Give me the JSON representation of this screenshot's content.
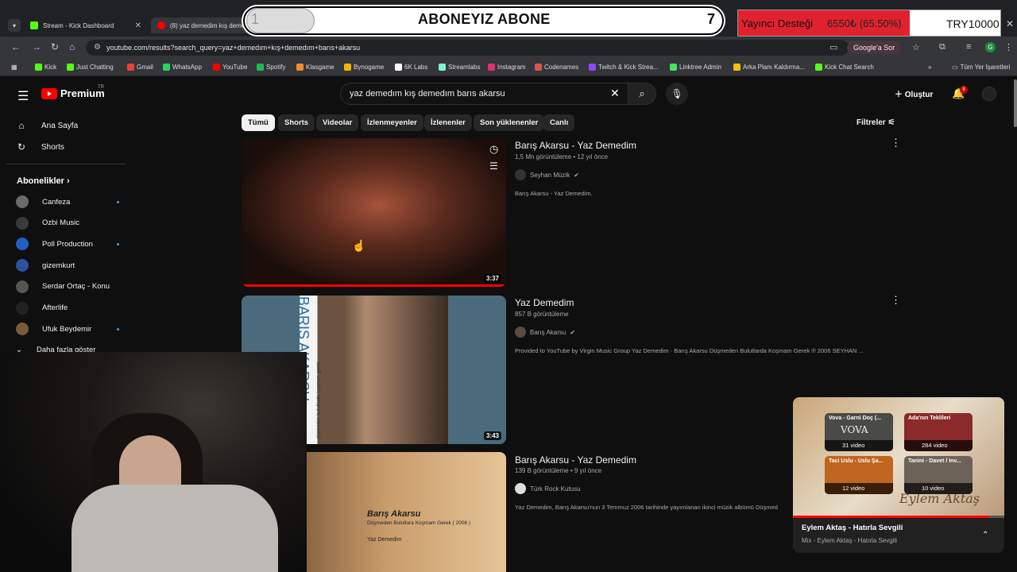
{
  "browser": {
    "tabs": [
      {
        "label": "Stream - Kick Dashboard",
        "favicon_color": "#53fc18"
      },
      {
        "label": "(8) yaz demedim kış demedi",
        "favicon_color": "#ff0000"
      }
    ],
    "url": "youtube.com/results?search_query=yaz+demedım+kış+demedım+barıs+akarsu",
    "google_sor": "Google'a Sor",
    "profile_initial": "G",
    "bookmarks": [
      {
        "label": "Kick",
        "color": "#53fc18"
      },
      {
        "label": "Just Chatting",
        "color": "#53fc18"
      },
      {
        "label": "Gmail",
        "color": "#ea4335"
      },
      {
        "label": "WhatsApp",
        "color": "#25d366"
      },
      {
        "label": "YouTube",
        "color": "#ff0000"
      },
      {
        "label": "Spotify",
        "color": "#1db954"
      },
      {
        "label": "Klasgame",
        "color": "#f28c28"
      },
      {
        "label": "Bynogame",
        "color": "#f4b400"
      },
      {
        "label": "6K Labs",
        "color": "#ffffff"
      },
      {
        "label": "Streamlabs",
        "color": "#80f5d2"
      },
      {
        "label": "Instagram",
        "color": "#e1306c"
      },
      {
        "label": "Codenames",
        "color": "#d9534f"
      },
      {
        "label": "Twitch & Kick Strea...",
        "color": "#9146ff"
      },
      {
        "label": "Linktree Admin",
        "color": "#43e55e"
      },
      {
        "label": "Arka Planı Kaldırma...",
        "color": "#f6c000"
      },
      {
        "label": "Kick Chat Search",
        "color": "#53fc18"
      }
    ],
    "all_bookmarks": "Tüm Yer İşaretleri"
  },
  "overlay": {
    "left_number": "1",
    "title": "ABONEYIZ ABONE",
    "right_number": "7",
    "donation_label": "Yayıncı Desteği",
    "donation_progress_text": "6550₺ (65.50%)",
    "donation_progress": 0.655,
    "donation_goal": "TRY10000"
  },
  "youtube": {
    "logo": "Premium",
    "logo_region": "TR",
    "search_query": "yaz demedım kış demedım barıs akarsu",
    "create_label": "Oluştur",
    "notif_count": "8",
    "sidebar": {
      "home": "Ana Sayfa",
      "shorts": "Shorts",
      "subs_heading": "Abonelikler",
      "more": "Daha fazla göster",
      "subscriptions": [
        {
          "name": "Canfeza",
          "dot": true,
          "color": "#6b6b6b"
        },
        {
          "name": "Ozbi Music",
          "dot": false,
          "color": "#3a3a3a"
        },
        {
          "name": "Poll Production",
          "dot": true,
          "color": "#2060c0"
        },
        {
          "name": "gizemkurt",
          "dot": false,
          "color": "#3050a0"
        },
        {
          "name": "Serdar Ortaç - Konu",
          "dot": false,
          "color": "#555"
        },
        {
          "name": "Afterlife",
          "dot": false,
          "color": "#222"
        },
        {
          "name": "Ufuk Beydemir",
          "dot": true,
          "color": "#7a5a3a"
        }
      ]
    },
    "chips": [
      "Tümü",
      "Shorts",
      "Videolar",
      "İzlenmeyenler",
      "İzlenenler",
      "Son yüklenenler",
      "Canlı"
    ],
    "filters_label": "Filtreler",
    "results": [
      {
        "title": "Barış Akarsu - Yaz Demedim",
        "meta": "1,5 Mn görüntüleme • 12 yıl önce",
        "channel": "Seyhan Müzik",
        "description": "Barış Akarsu - Yaz Demedim.",
        "duration": "3:37",
        "watched": 1.0
      },
      {
        "title": "Yaz Demedim",
        "meta": "857 B görüntüleme",
        "channel": "Barış Akarsu",
        "description": "Provided to YouTube by Virgin Music Group Yaz Demedim · Barış Akarsu Düşmeden Bulutlarda Koşmam Gerek ℗ 2006 SEYHAN ...",
        "duration": "3:43",
        "thumb_text": "BARIŞ AKARSU",
        "thumb_subtext": "düşmeden bulutlarda koşmam gerek"
      },
      {
        "title": "Barış Akarsu - Yaz Demedim",
        "meta": "139 B görüntüleme • 9 yıl önce",
        "channel": "Türk Rock Kutusu",
        "description": "Yaz Demedim, Barış Akarsu'nun 3 Temmuz 2006 tarihinde yayımlanan ikinci müzik albümü Düşmed",
        "thumb_name": "Barış Akarsu",
        "thumb_album": "Düşmeden Bulutlara Koşmam Gerek ( 2006 )",
        "thumb_song": "Yaz Demedim"
      }
    ],
    "miniplayer": {
      "title": "Eylem Aktaş - Hatırla Sevgili",
      "subtitle": "Mix - Eylem Aktaş - Hatırla Sevgili",
      "art_text": "Eylem Aktaş",
      "progress": 0.93,
      "cards": [
        {
          "title": "Vova - Garni Doç (...",
          "count": "31 video",
          "art": "VOVA"
        },
        {
          "title": "Ada'nın Teklileri",
          "count": "284 video"
        },
        {
          "title": "Taci Uslu - Uslu Şa...",
          "count": "12 video"
        },
        {
          "title": "Tanini - Davet / Inv...",
          "count": "10 video"
        }
      ]
    }
  }
}
